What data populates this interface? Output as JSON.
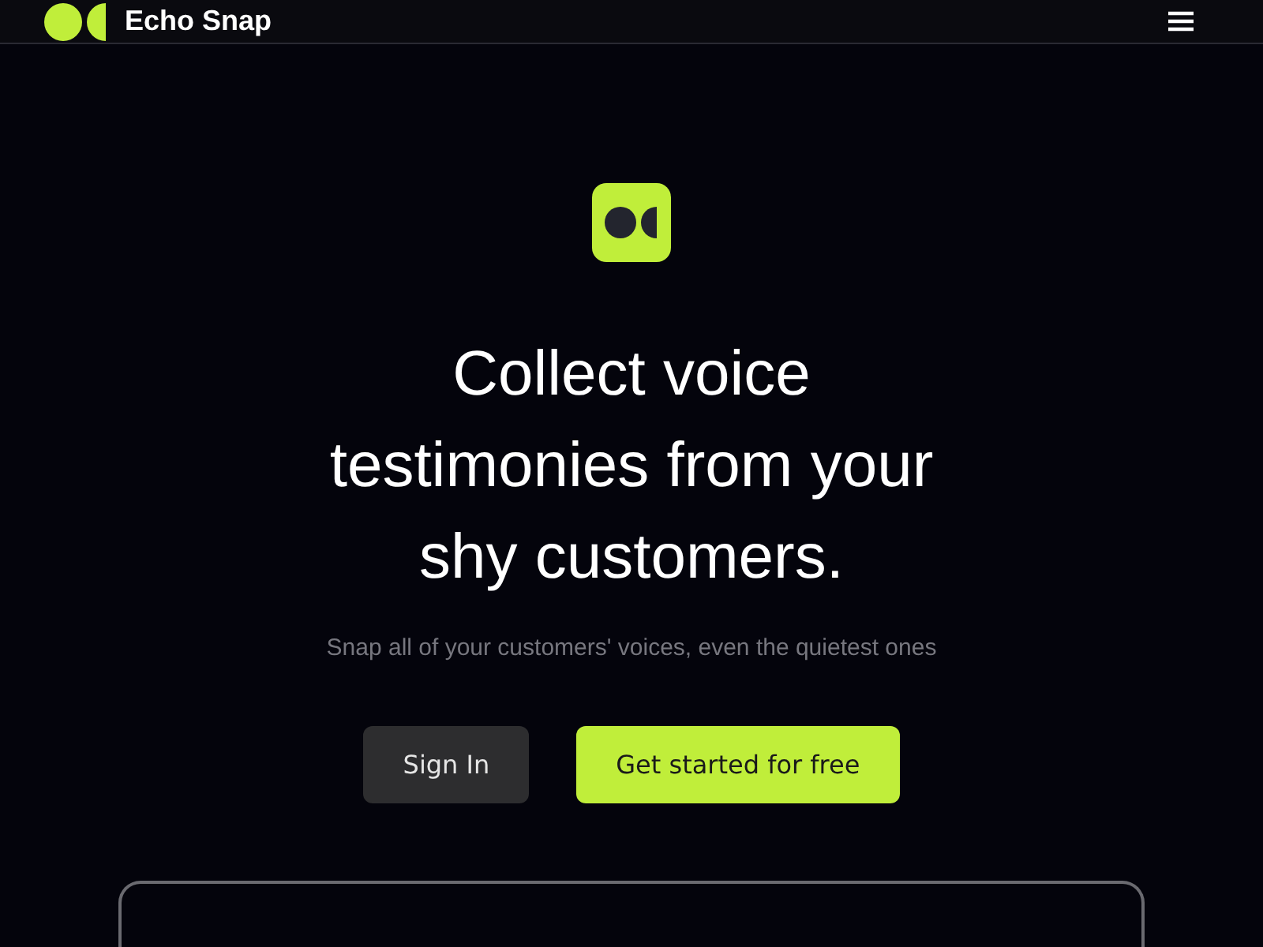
{
  "header": {
    "brand": "Echo Snap"
  },
  "hero": {
    "headline": "Collect voice testimonies from your shy customers.",
    "subtitle": "Snap all of your customers' voices, even the quietest ones"
  },
  "buttons": [
    {
      "label": "Sign In",
      "kind": "secondary"
    },
    {
      "label": "Get started for free",
      "kind": "primary"
    }
  ]
}
